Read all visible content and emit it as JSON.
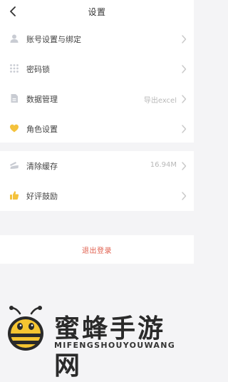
{
  "header": {
    "title": "设置"
  },
  "group1": [
    {
      "label": "账号设置与绑定",
      "value": "",
      "icon": "user-icon"
    },
    {
      "label": "密码锁",
      "value": "",
      "icon": "grid-dots-icon"
    },
    {
      "label": "数据管理",
      "value": "导出excel",
      "icon": "document-icon"
    },
    {
      "label": "角色设置",
      "value": "",
      "icon": "heart-icon"
    }
  ],
  "group2": [
    {
      "label": "清除缓存",
      "value": "16.94M",
      "icon": "broom-icon"
    },
    {
      "label": "好评鼓励",
      "value": "",
      "icon": "thumbs-up-icon"
    }
  ],
  "logout": {
    "label": "退出登录"
  },
  "watermark": {
    "name": "蜜蜂手游网",
    "sub": "MIFENGSHOUYOUWANG"
  },
  "colors": {
    "accent": "#e0604f",
    "icon_gray": "#c9ccd3",
    "icon_yellow": "#f4c23c",
    "background": "#f4f4f6"
  }
}
